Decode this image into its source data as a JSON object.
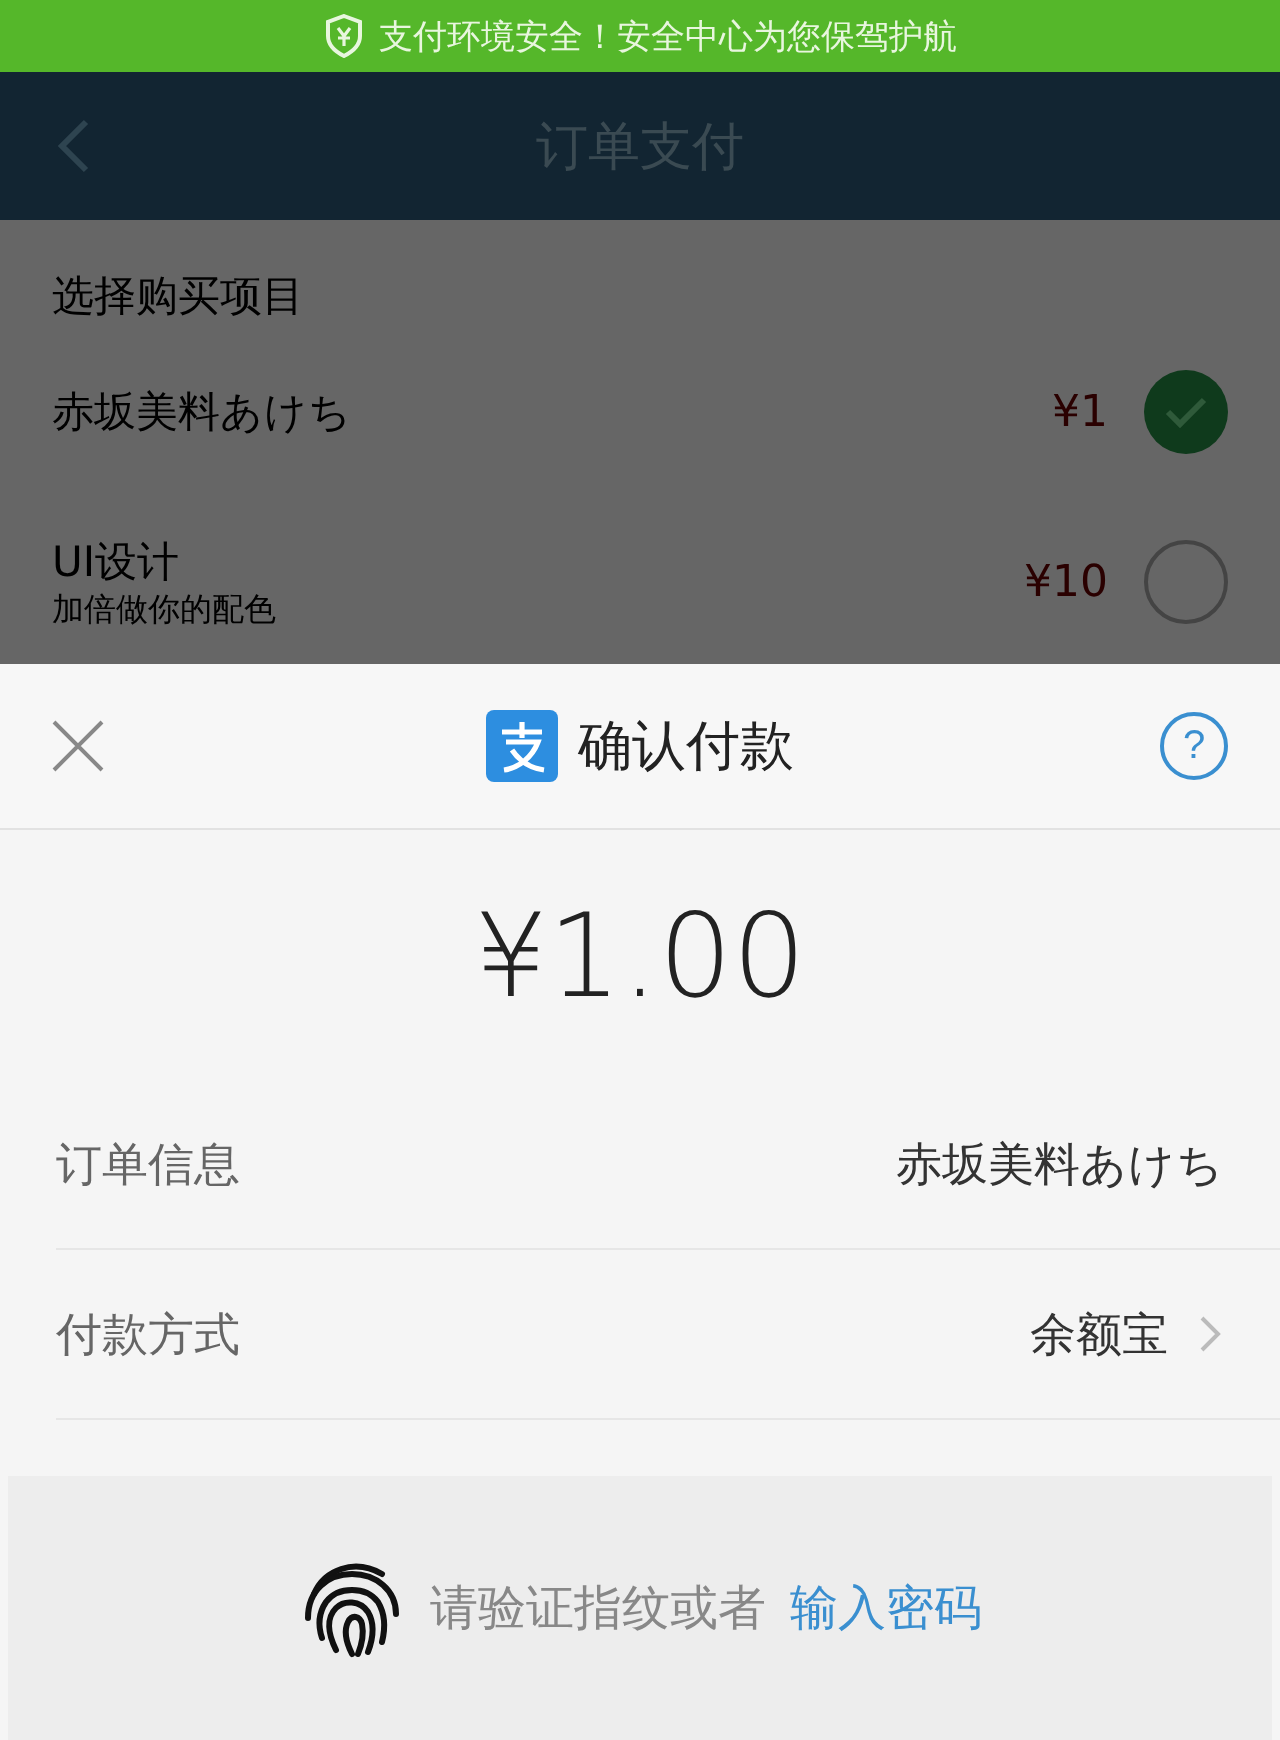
{
  "security_banner": {
    "text": "支付环境安全！安全中心为您保驾护航"
  },
  "nav": {
    "title": "订单支付"
  },
  "section_title": "选择购买项目",
  "items": [
    {
      "name": "赤坂美料あけち",
      "price": "¥1",
      "selected": true
    },
    {
      "name": "UI设计",
      "subtitle": "加倍做你的配色",
      "price": "¥10",
      "selected": false
    }
  ],
  "sheet": {
    "title": "确认付款",
    "help": "?",
    "amount": "¥1.00",
    "rows": [
      {
        "label": "订单信息",
        "value": "赤坂美料あけち",
        "chevron": false
      },
      {
        "label": "付款方式",
        "value": "余额宝",
        "chevron": true
      }
    ],
    "verify": {
      "text": "请验证指纹或者",
      "link": "输入密码"
    }
  }
}
